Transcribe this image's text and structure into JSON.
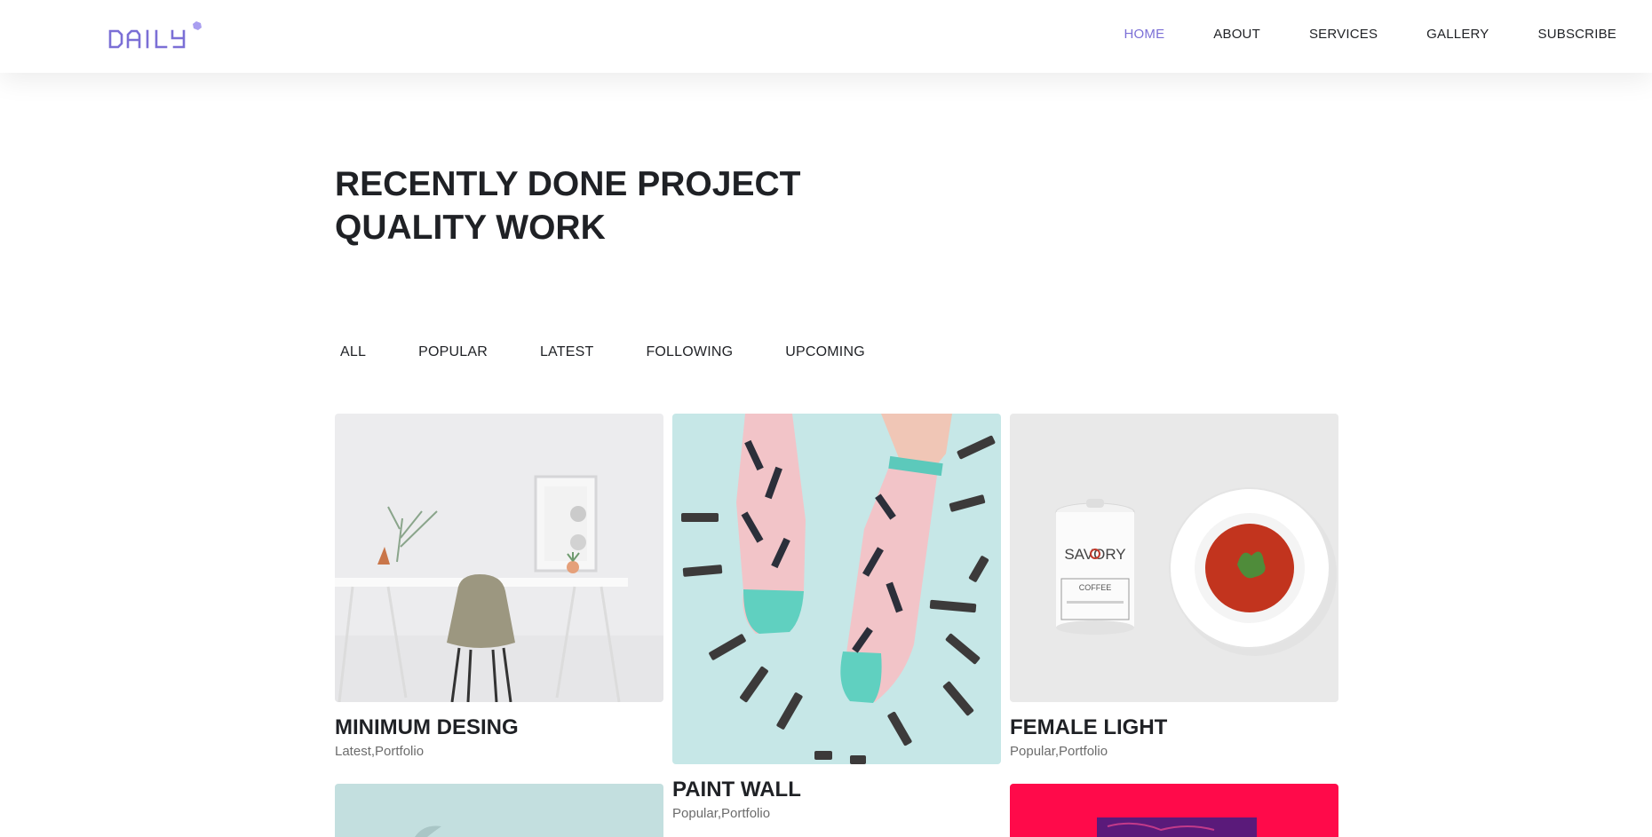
{
  "brand": {
    "logo_text": "DAILY",
    "accent": "#7b6fd6"
  },
  "nav": {
    "items": [
      {
        "label": "HOME",
        "active": true
      },
      {
        "label": "ABOUT",
        "active": false
      },
      {
        "label": "SERVICES",
        "active": false
      },
      {
        "label": "GALLERY",
        "active": false
      },
      {
        "label": "SUBSCRIBE",
        "active": false
      }
    ]
  },
  "section": {
    "title_line1": "RECENTLY DONE PROJECT",
    "title_line2": "QUALITY WORK"
  },
  "filters": [
    "ALL",
    "POPULAR",
    "LATEST",
    "FOLLOWING",
    "UPCOMING"
  ],
  "projects": [
    {
      "title": "MINIMUM DESING",
      "tags": "Latest,Portfolio",
      "image": "desk-chair-photo"
    },
    {
      "title": "PAINT WALL",
      "tags": "Popular,Portfolio",
      "image": "patterned-socks-photo"
    },
    {
      "title": "FEMALE LIGHT",
      "tags": "Popular,Portfolio",
      "image": "coffee-can-and-soup-photo"
    },
    {
      "title": "",
      "tags": "",
      "image": "mint-background-photo"
    },
    {
      "title": "",
      "tags": "",
      "image": "pink-poster-photo"
    }
  ]
}
